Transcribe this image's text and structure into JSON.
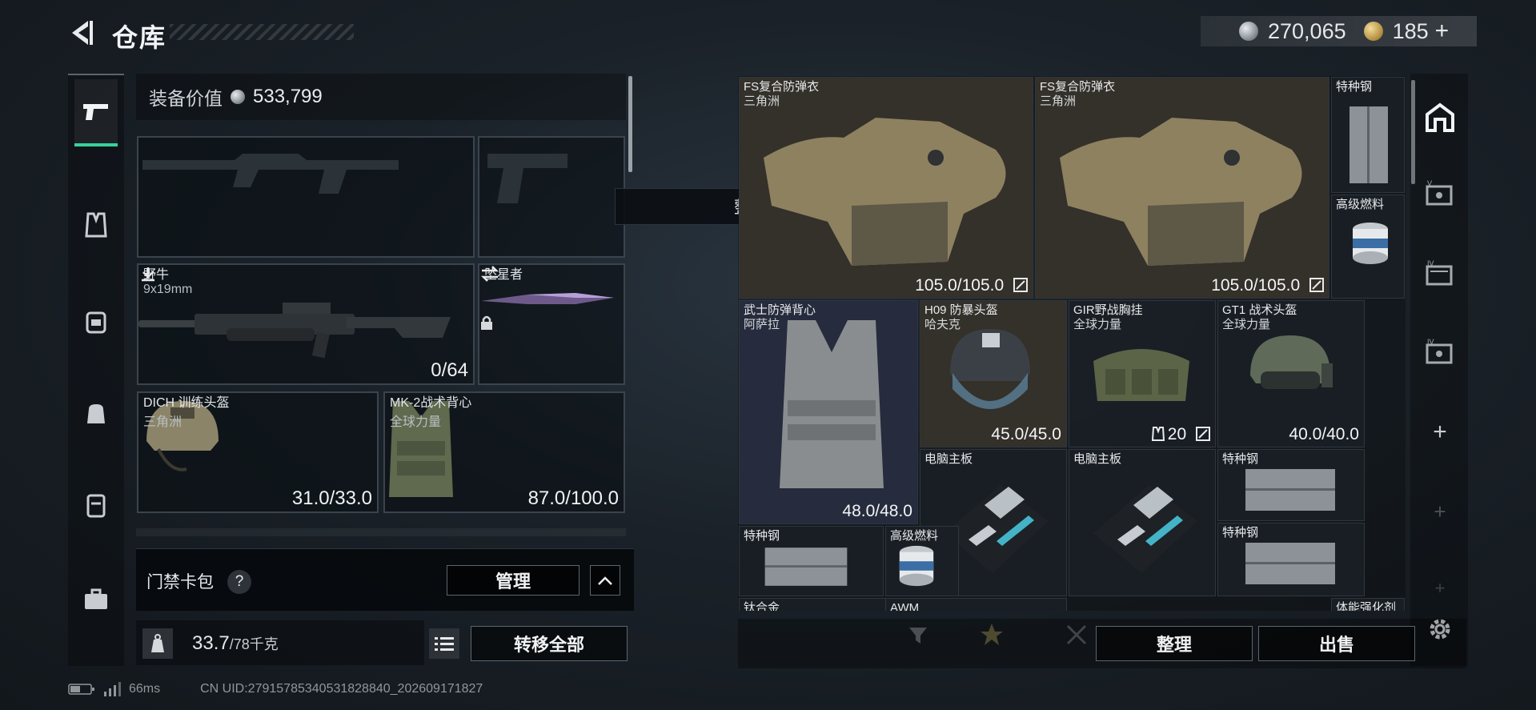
{
  "header": {
    "title": "仓库",
    "currency_silver": "270,065",
    "currency_gold": "185",
    "plus": "+"
  },
  "toast": "整理成功",
  "loadout": {
    "equip_value_label": "装备价值",
    "equip_value": "533,799",
    "primary": {
      "name": "野牛",
      "ammo": "9x19mm",
      "count": "0/64"
    },
    "melee": {
      "name": "坠星者"
    },
    "helmet": {
      "name": "DICH 训练头盔",
      "source": "三角洲",
      "durability": "31.0/33.0"
    },
    "vest": {
      "name": "MK-2战术背心",
      "source": "全球力量",
      "durability": "87.0/100.0"
    }
  },
  "access_card": {
    "label": "门禁卡包",
    "help": "?",
    "manage": "管理"
  },
  "weight": {
    "current": "33.7",
    "max": "/78千克"
  },
  "transfer_all": "转移全部",
  "status": {
    "latency": "66ms",
    "uid": "CN UID:2791578534053182884​0_202609171827"
  },
  "stash": {
    "items": [
      {
        "name": "FS复合防弹衣",
        "source": "三角洲",
        "value": "105.0/105.0"
      },
      {
        "name": "FS复合防弹衣",
        "source": "三角洲",
        "value": "105.0/105.0"
      },
      {
        "name": "特种钢",
        "source": "",
        "value": ""
      },
      {
        "name": "高级燃料",
        "source": "",
        "value": ""
      },
      {
        "name": "武士防弹背心",
        "source": "阿萨拉",
        "value": "48.0/48.0"
      },
      {
        "name": "H09 防暴头盔",
        "source": "哈夫克",
        "value": "45.0/45.0"
      },
      {
        "name": "GIR野战胸挂",
        "source": "全球力量",
        "value": "20"
      },
      {
        "name": "GT1 战术头盔",
        "source": "全球力量",
        "value": "40.0/40.0"
      },
      {
        "name": "电脑主板",
        "source": "",
        "value": ""
      },
      {
        "name": "电脑主板",
        "source": "",
        "value": ""
      },
      {
        "name": "特种钢",
        "source": "",
        "value": ""
      },
      {
        "name": "特种钢",
        "source": "",
        "value": ""
      },
      {
        "name": "高级燃料",
        "source": "",
        "value": ""
      },
      {
        "name": "特种钢",
        "source": "",
        "value": ""
      },
      {
        "name": "钛合金",
        "source": "",
        "value": ""
      },
      {
        "name": "AWM",
        "source": "",
        "value": ""
      },
      {
        "name": "体能强化剂",
        "source": "",
        "value": ""
      }
    ]
  },
  "actions": {
    "sort": "整理",
    "sell": "出售"
  },
  "right_nav": {
    "plus": "+"
  },
  "colors": {
    "accent": "#39d19b",
    "cell_brown": "#34302a",
    "cell_navy": "#262b3d"
  }
}
